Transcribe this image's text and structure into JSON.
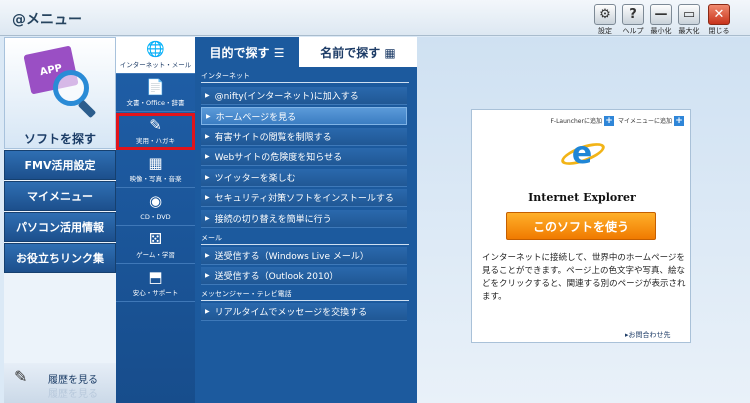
{
  "window": {
    "title": "@メニュー",
    "buttons": [
      {
        "label": "設定",
        "glyph": "⚙"
      },
      {
        "label": "ヘルプ",
        "glyph": "?"
      },
      {
        "label": "最小化",
        "glyph": "—"
      },
      {
        "label": "最大化",
        "glyph": "▭"
      },
      {
        "label": "閉じる",
        "glyph": "✕"
      }
    ]
  },
  "sidebar": {
    "soft_tile_label": "ソフトを探す",
    "app_icon_text": "APP",
    "nav": [
      "FMV活用設定",
      "マイメニュー",
      "パソコン活用情報",
      "お役立ちリンク集"
    ],
    "history_label": "履歴を見る",
    "history_ghost": "履歴を見る"
  },
  "categories": [
    {
      "label": "インターネット・メール",
      "icon": "globe-mail-icon",
      "glyph": "🌐"
    },
    {
      "label": "文書・Office・辞書",
      "icon": "document-icon",
      "glyph": "📄"
    },
    {
      "label": "実用・ハガキ",
      "icon": "pen-note-icon",
      "glyph": "✎"
    },
    {
      "label": "映像・写真・音楽",
      "icon": "film-icon",
      "glyph": "▦"
    },
    {
      "label": "CD・DVD",
      "icon": "disc-icon",
      "glyph": "◉"
    },
    {
      "label": "ゲーム・学習",
      "icon": "dice-icon",
      "glyph": "⚄"
    },
    {
      "label": "安心・サポート",
      "icon": "gift-icon",
      "glyph": "⬒"
    }
  ],
  "tabs": {
    "purpose": "目的で探す ☰",
    "name": "名前で探す ▦"
  },
  "sections": [
    {
      "title": "インターネット",
      "items": [
        "@nifty(インターネット)に加入する",
        "ホームページを見る",
        "有害サイトの閲覧を制限する",
        "Webサイトの危険度を知らせる",
        "ツイッターを楽しむ",
        "セキュリティ対策ソフトをインストールする",
        "接続の切り替えを簡単に行う"
      ]
    },
    {
      "title": "メール",
      "items": [
        "送受信する（Windows Live メール）",
        "送受信する（Outlook 2010）"
      ]
    },
    {
      "title": "メッセンジャー・テレビ電話",
      "items": [
        "リアルタイムでメッセージを交換する"
      ]
    }
  ],
  "selected_item": "ホームページを見る",
  "highlighted_category": "実用・ハガキ",
  "detail": {
    "add_flauncher": "F-Launcherに追加",
    "add_mymenu": "マイメニューに追加",
    "app_name": "Internet Explorer",
    "use_button": "このソフトを使う",
    "description": "インターネットに接続して、世界中のホームページを見ることができます。ページ上の色文字や写真、絵などをクリックすると、関連する別のページが表示されます。",
    "contact": "▸お問合わせ先"
  },
  "colors": {
    "accent_blue": "#1c5a9e",
    "highlight_red": "#e1141b",
    "use_button_orange": "#f07a00"
  }
}
